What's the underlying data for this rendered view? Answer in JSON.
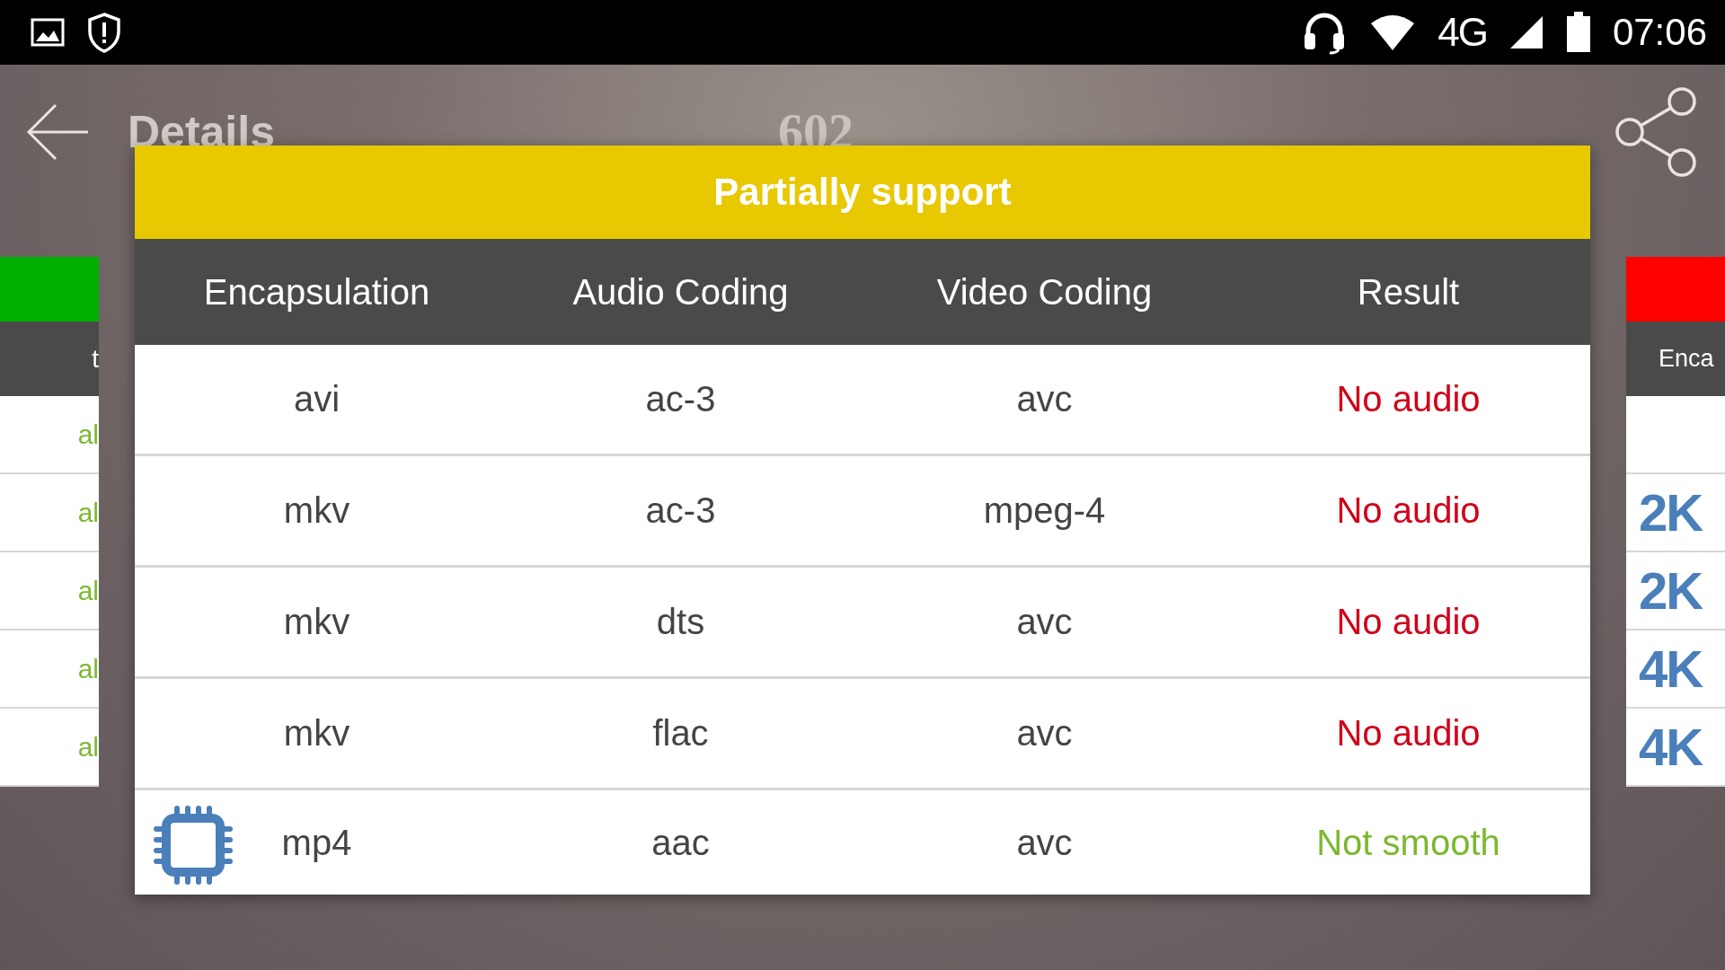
{
  "status_bar": {
    "network": "4G",
    "time": "07:06"
  },
  "app_bar": {
    "title": "Details",
    "subtitle": "602"
  },
  "left_card": {
    "header_text": "t",
    "rows": [
      "al",
      "al",
      "al",
      "al",
      "al"
    ]
  },
  "right_card": {
    "header_text": "Enca",
    "rows": [
      {},
      {
        "badge": "2K"
      },
      {
        "badge": "2K"
      },
      {
        "badge": "4K"
      },
      {
        "badge": "4K"
      }
    ]
  },
  "dialog": {
    "title": "Partially support",
    "columns": [
      "Encapsulation",
      "Audio Coding",
      "Video Coding",
      "Result"
    ],
    "rows": [
      {
        "encapsulation": "avi",
        "audio": "ac-3",
        "video": "avc",
        "result": "No audio",
        "color": "#d0021b",
        "has_icon": false
      },
      {
        "encapsulation": "mkv",
        "audio": "ac-3",
        "video": "mpeg-4",
        "result": "No audio",
        "color": "#d0021b",
        "has_icon": false
      },
      {
        "encapsulation": "mkv",
        "audio": "dts",
        "video": "avc",
        "result": "No audio",
        "color": "#d0021b",
        "has_icon": false
      },
      {
        "encapsulation": "mkv",
        "audio": "flac",
        "video": "avc",
        "result": "No audio",
        "color": "#d0021b",
        "has_icon": false
      },
      {
        "encapsulation": "mp4",
        "audio": "aac",
        "video": "avc",
        "result": "Not smooth",
        "color": "#7cb82f",
        "has_icon": true
      }
    ]
  }
}
